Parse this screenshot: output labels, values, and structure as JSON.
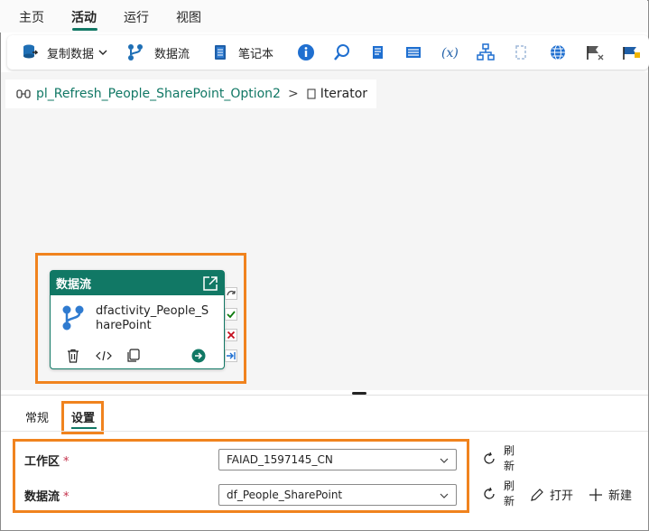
{
  "menu": {
    "tabs": [
      "主页",
      "活动",
      "运行",
      "视图"
    ],
    "active": "活动"
  },
  "toolbar": {
    "copy_data": "复制数据",
    "dataflow": "数据流",
    "notebook": "笔记本"
  },
  "breadcrumb": {
    "pipeline": "pl_Refresh_People_SharePoint_Option2",
    "separator": ">",
    "current": "Iterator"
  },
  "activity": {
    "type_label": "数据流",
    "name": "dfactivity_People_SharePoint"
  },
  "panel": {
    "tabs": [
      "常规",
      "设置"
    ],
    "active_tab": "设置",
    "workspace_label": "工作区",
    "workspace_value": "FAIAD_1597145_CN",
    "dataflow_label": "数据流",
    "dataflow_value": "df_People_SharePoint",
    "required_mark": "*",
    "refresh_label": "刷新",
    "open_label": "打开",
    "new_label": "新建"
  },
  "colors": {
    "accent": "#117865",
    "highlight": "#f0831e",
    "required": "#c4314b"
  }
}
